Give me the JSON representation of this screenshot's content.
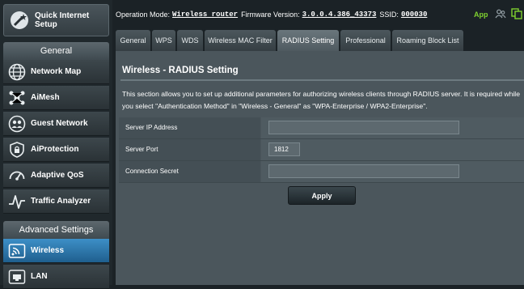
{
  "sidebar": {
    "quick_setup_line1": "Quick Internet",
    "quick_setup_line2": "Setup",
    "general_header": "General",
    "general_items": [
      {
        "label": "Network Map",
        "icon": "network-map-icon"
      },
      {
        "label": "AiMesh",
        "icon": "aimesh-icon"
      },
      {
        "label": "Guest Network",
        "icon": "guest-network-icon"
      },
      {
        "label": "AiProtection",
        "icon": "aiprotection-icon"
      },
      {
        "label": "Adaptive QoS",
        "icon": "adaptive-qos-icon"
      },
      {
        "label": "Traffic Analyzer",
        "icon": "traffic-analyzer-icon"
      }
    ],
    "advanced_header": "Advanced Settings",
    "advanced_items": [
      {
        "label": "Wireless",
        "icon": "wireless-icon",
        "active": true
      },
      {
        "label": "LAN",
        "icon": "lan-icon",
        "active": false
      }
    ]
  },
  "topbar": {
    "mode_label": "Operation Mode:",
    "mode_value": "Wireless router",
    "firmware_label": "Firmware Version:",
    "firmware_value": "3.0.0.4.386_43373",
    "ssid_label": "SSID:",
    "ssid_value": "000030",
    "app_label": "App"
  },
  "tabs": [
    "General",
    "WPS",
    "WDS",
    "Wireless MAC Filter",
    "RADIUS Setting",
    "Professional",
    "Roaming Block List"
  ],
  "active_tab": "RADIUS Setting",
  "page": {
    "title": "Wireless - RADIUS Setting",
    "description_line1": "This section allows you to set up additional parameters for authorizing wireless clients through RADIUS server. It is required while",
    "description_line2": "you select \"Authentication Method\" in \"Wireless - General\" as \"WPA-Enterprise / WPA2-Enterprise\"."
  },
  "form": {
    "server_ip_label": "Server IP Address",
    "server_ip_value": "",
    "server_port_label": "Server Port",
    "server_port_value": "1812",
    "secret_label": "Connection Secret",
    "secret_value": ""
  },
  "apply_label": "Apply",
  "colors": {
    "accent_blue": "#2f7cb5",
    "app_green": "#7fd130",
    "content_bg": "#4b565c",
    "page_bg": "#1b2226"
  }
}
